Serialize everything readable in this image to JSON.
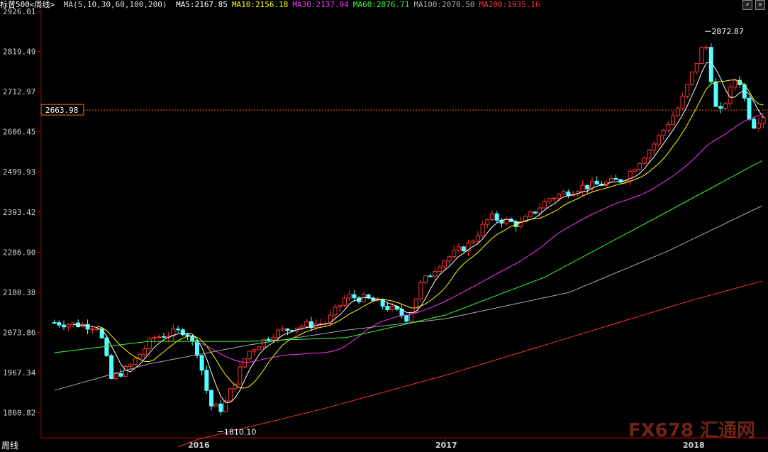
{
  "header": {
    "symbol": "标普500<周线>",
    "ma_spec": "MA(5,10,30,60,100,200)",
    "ma_values": [
      {
        "label": "MA5:2167.85",
        "color": "#ffffff"
      },
      {
        "label": "MA10:2156.18",
        "color": "#ffff00"
      },
      {
        "label": "MA30:2137.94",
        "color": "#ff33ff"
      },
      {
        "label": "MA60:2076.71",
        "color": "#33ff33"
      },
      {
        "label": "MA100:2070.50",
        "color": "#aaaaaa"
      },
      {
        "label": "MA200:1935.16",
        "color": "#ff3333"
      }
    ]
  },
  "period_label": "周线",
  "watermark": "FX678 汇通网",
  "colors": {
    "up": "#ff3232",
    "down": "#54ffff",
    "axis": "#b00000",
    "current": "#ff6a00"
  },
  "chart_data": {
    "type": "candlestick",
    "ylim": [
      1810,
      2926.01
    ],
    "y_ticks": [
      1860.82,
      1967.34,
      2073.86,
      2180.38,
      2286.9,
      2393.42,
      2499.93,
      2606.45,
      2712.97,
      2819.49,
      2926.01
    ],
    "x_ticks": [
      "2016",
      "2017",
      "2018"
    ],
    "current_price": "2663.98",
    "annotations": [
      {
        "label": "2872.87",
        "value": 2872.87,
        "year": 2018.05
      },
      {
        "label": "1810.10",
        "value": 1810.1,
        "year": 2016.08
      }
    ],
    "anchors": [
      [
        2015.42,
        2100
      ],
      [
        2015.6,
        2090
      ],
      [
        2015.65,
        1950
      ],
      [
        2015.72,
        1980
      ],
      [
        2015.82,
        2060
      ],
      [
        2015.95,
        2080
      ],
      [
        2016.0,
        2020
      ],
      [
        2016.05,
        1880
      ],
      [
        2016.1,
        1870
      ],
      [
        2016.2,
        2020
      ],
      [
        2016.3,
        2070
      ],
      [
        2016.4,
        2090
      ],
      [
        2016.52,
        2100
      ],
      [
        2016.6,
        2170
      ],
      [
        2016.7,
        2160
      ],
      [
        2016.8,
        2130
      ],
      [
        2016.85,
        2110
      ],
      [
        2016.9,
        2200
      ],
      [
        2016.98,
        2260
      ],
      [
        2017.1,
        2310
      ],
      [
        2017.18,
        2380
      ],
      [
        2017.3,
        2360
      ],
      [
        2017.42,
        2430
      ],
      [
        2017.55,
        2460
      ],
      [
        2017.65,
        2470
      ],
      [
        2017.72,
        2480
      ],
      [
        2017.85,
        2580
      ],
      [
        2017.95,
        2680
      ],
      [
        2018.05,
        2850
      ],
      [
        2018.1,
        2640
      ],
      [
        2018.18,
        2760
      ],
      [
        2018.24,
        2620
      ],
      [
        2018.28,
        2650
      ]
    ],
    "ma_lines": [
      {
        "name": "MA200",
        "color": "#ff3333",
        "points": [
          [
            2015.92,
            1770
          ],
          [
            2016.0,
            1790
          ],
          [
            2016.5,
            1870
          ],
          [
            2017.0,
            1960
          ],
          [
            2017.5,
            2060
          ],
          [
            2018.0,
            2160
          ],
          [
            2018.28,
            2210
          ]
        ]
      },
      {
        "name": "MA100",
        "color": "#aaaaaa",
        "points": [
          [
            2015.42,
            1920
          ],
          [
            2015.8,
            1990
          ],
          [
            2016.2,
            2040
          ],
          [
            2016.6,
            2080
          ],
          [
            2017.0,
            2110
          ],
          [
            2017.5,
            2180
          ],
          [
            2017.9,
            2290
          ],
          [
            2018.28,
            2410
          ]
        ]
      },
      {
        "name": "MA60",
        "color": "#33ff33",
        "points": [
          [
            2015.42,
            2020
          ],
          [
            2015.8,
            2050
          ],
          [
            2016.2,
            2050
          ],
          [
            2016.6,
            2060
          ],
          [
            2017.0,
            2120
          ],
          [
            2017.4,
            2220
          ],
          [
            2017.8,
            2360
          ],
          [
            2018.28,
            2530
          ]
        ]
      }
    ]
  }
}
